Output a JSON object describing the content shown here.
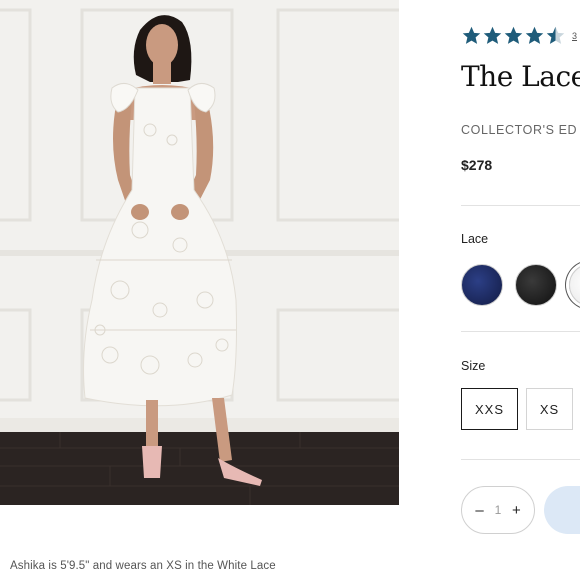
{
  "product": {
    "title": "The Lace",
    "subtitle": "COLLECTOR'S ED",
    "price": "$278",
    "rating": {
      "value": 4.5,
      "max": 5,
      "count_text": "3",
      "star_color": "#1f5c7a"
    }
  },
  "color_option": {
    "label": "Lace",
    "swatches": [
      {
        "name": "navy",
        "color": "#1f2c66"
      },
      {
        "name": "black",
        "color": "#1c1c1c"
      },
      {
        "name": "white",
        "color": "#f2f2f2",
        "selected": true
      }
    ]
  },
  "size_option": {
    "label": "Size",
    "sizes": [
      {
        "label": "XXS",
        "selected": true
      },
      {
        "label": "XS",
        "selected": false
      }
    ]
  },
  "quantity": {
    "minus": "–",
    "value": "1",
    "plus": "+"
  },
  "photo": {
    "caption": "Ashika is 5'9.5\" and wears an XS in the White Lace",
    "wall_color": "#f2f1ee",
    "floor_color": "#2b2422"
  },
  "colors": {
    "accent": "#1f5c7a",
    "add_to_bag": "#dce8f6"
  }
}
